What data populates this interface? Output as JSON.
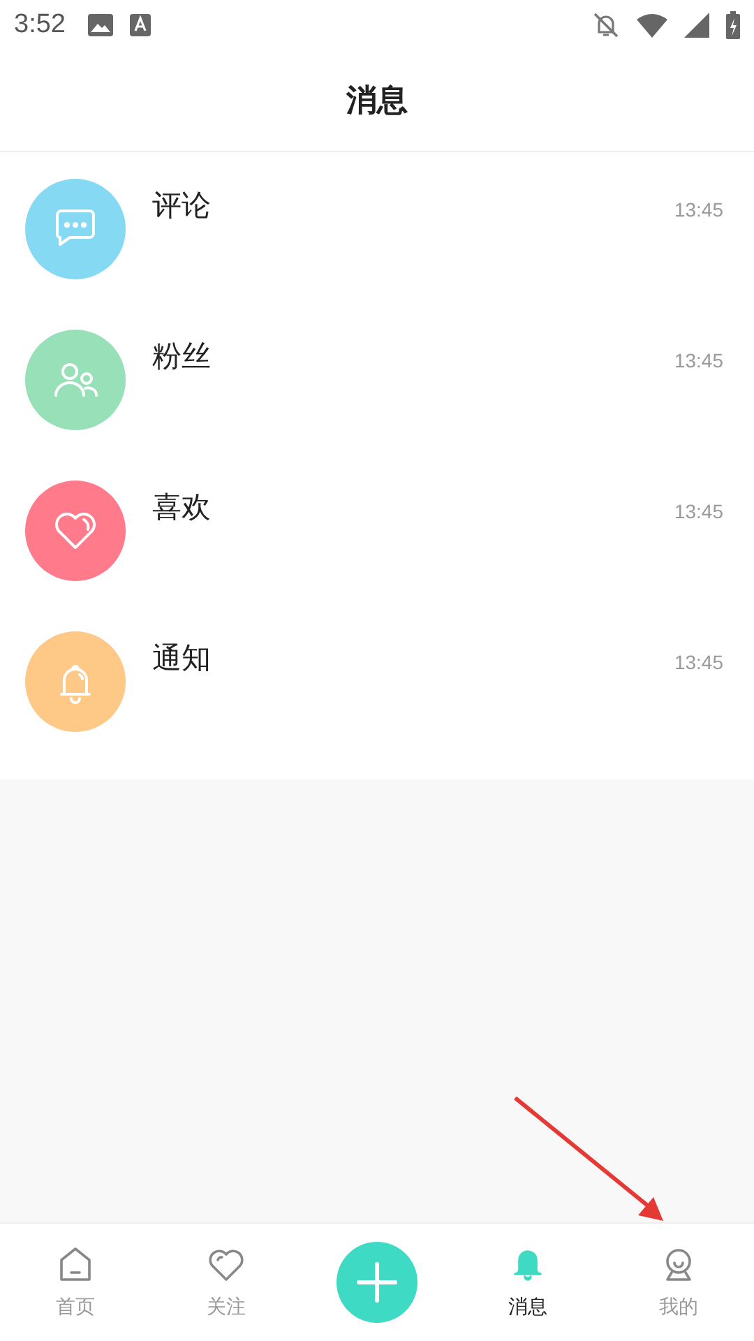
{
  "status_bar": {
    "time": "3:52"
  },
  "header": {
    "title": "消息"
  },
  "messages": [
    {
      "kind": "comment",
      "title": "评论",
      "time": "13:45",
      "color": "#86d9f3"
    },
    {
      "kind": "fans",
      "title": "粉丝",
      "time": "13:45",
      "color": "#97e0b8"
    },
    {
      "kind": "like",
      "title": "喜欢",
      "time": "13:45",
      "color": "#ff7b8c"
    },
    {
      "kind": "notice",
      "title": "通知",
      "time": "13:45",
      "color": "#fec887"
    }
  ],
  "bottom_nav": [
    {
      "kind": "home",
      "label": "首页",
      "selected": false
    },
    {
      "kind": "follow",
      "label": "关注",
      "selected": false
    },
    {
      "kind": "add",
      "selected": false
    },
    {
      "kind": "messages",
      "label": "消息",
      "selected": true
    },
    {
      "kind": "profile",
      "label": "我的",
      "selected": false
    }
  ]
}
